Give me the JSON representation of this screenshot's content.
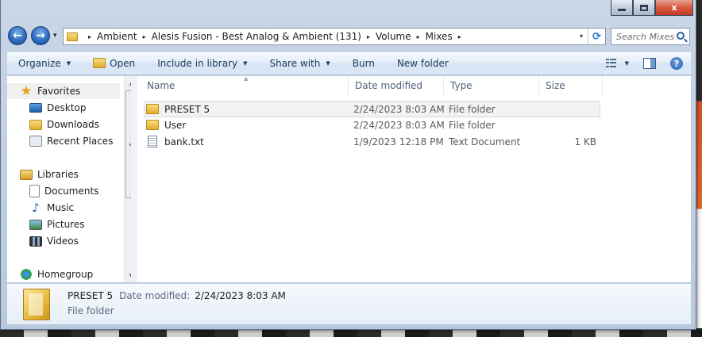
{
  "window": {
    "minimize_label": "",
    "close_label": "x"
  },
  "navigation": {
    "back_glyph": "←",
    "forward_glyph": "→",
    "history_glyph": "▾",
    "breadcrumbs": [
      "Ambient",
      "Alesis Fusion - Best Analog & Ambient (131)",
      "Volume",
      "Mixes"
    ],
    "separator_glyph": "▸",
    "address_dropdown_glyph": "▾",
    "refresh_glyph": "⟳",
    "search_placeholder": "Search Mixes"
  },
  "toolbar": {
    "organize_label": "Organize",
    "open_label": "Open",
    "include_label": "Include in library",
    "share_label": "Share with",
    "burn_label": "Burn",
    "new_folder_label": "New folder",
    "caret_glyph": "▼",
    "help_glyph": "?"
  },
  "nav_pane": {
    "favorites_label": "Favorites",
    "favorites": [
      {
        "label": "Desktop",
        "icon": "desktop-icon"
      },
      {
        "label": "Downloads",
        "icon": "downloads-icon"
      },
      {
        "label": "Recent Places",
        "icon": "recent-places-icon"
      }
    ],
    "libraries_label": "Libraries",
    "libraries": [
      {
        "label": "Documents",
        "icon": "documents-icon"
      },
      {
        "label": "Music",
        "icon": "music-icon"
      },
      {
        "label": "Pictures",
        "icon": "pictures-icon"
      },
      {
        "label": "Videos",
        "icon": "videos-icon"
      }
    ],
    "homegroup_label": "Homegroup",
    "scroll_up_glyph": "▲",
    "scroll_down_glyph": "▼",
    "scroll_grip_glyph": "≡"
  },
  "columns": {
    "name": "Name",
    "date": "Date modified",
    "type": "Type",
    "size": "Size",
    "sort_glyph": "▲"
  },
  "files": [
    {
      "name": "PRESET 5",
      "date": "2/24/2023 8:03 AM",
      "type": "File folder",
      "size": "",
      "icon": "folder-icon"
    },
    {
      "name": "User",
      "date": "2/24/2023 8:03 AM",
      "type": "File folder",
      "size": "",
      "icon": "folder-icon"
    },
    {
      "name": "bank.txt",
      "date": "1/9/2023 12:18 PM",
      "type": "Text Document",
      "size": "1 KB",
      "icon": "text-file-icon"
    }
  ],
  "details": {
    "name": "PRESET 5",
    "date_label": "Date modified:",
    "date_value": "2/24/2023 8:03 AM",
    "type": "File folder"
  },
  "colors": {
    "accent": "#1e395b",
    "selection": "#f2f2f2",
    "close_button": "#c23b21"
  }
}
